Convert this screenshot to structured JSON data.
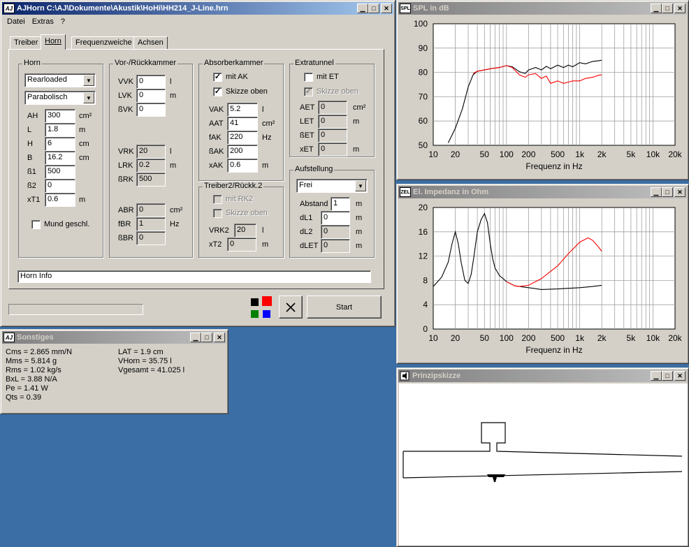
{
  "main_window": {
    "title": "AJHorn  C:\\AJ\\Dokumente\\Akustik\\HoHi\\HH214_J-Line.hrn",
    "icon": "AJ",
    "menu": [
      "Datei",
      "Extras",
      "?"
    ],
    "tabs": [
      "Treiber",
      "Horn",
      "Frequenzweiche",
      "Achsen"
    ],
    "active_tab": "Horn",
    "horn": {
      "label": "Horn",
      "type_select": "Rearloaded",
      "profile_select": "Parabolisch",
      "params": [
        {
          "name": "AH",
          "value": "300",
          "unit": "cm²"
        },
        {
          "name": "L",
          "value": "1.8",
          "unit": "m"
        },
        {
          "name": "H",
          "value": "6",
          "unit": "cm"
        },
        {
          "name": "B",
          "value": "16.2",
          "unit": "cm"
        },
        {
          "name": "ß1",
          "value": "500",
          "unit": ""
        },
        {
          "name": "ß2",
          "value": "0",
          "unit": ""
        },
        {
          "name": "xT1",
          "value": "0.6",
          "unit": "m"
        }
      ],
      "mouth_closed_label": "Mund geschl.",
      "mouth_closed_checked": false
    },
    "vor_rueck": {
      "label": "Vor-/Rückkammer",
      "params_top": [
        {
          "name": "VVK",
          "value": "0",
          "unit": "l"
        },
        {
          "name": "LVK",
          "value": "0",
          "unit": "m"
        },
        {
          "name": "ßVK",
          "value": "0",
          "unit": ""
        }
      ],
      "params_mid": [
        {
          "name": "VRK",
          "value": "20",
          "unit": "l"
        },
        {
          "name": "LRK",
          "value": "0.2",
          "unit": "m"
        },
        {
          "name": "ßRK",
          "value": "500",
          "unit": ""
        }
      ],
      "params_bot": [
        {
          "name": "ABR",
          "value": "0",
          "unit": "cm²"
        },
        {
          "name": "fBR",
          "value": "1",
          "unit": "Hz"
        },
        {
          "name": "ßBR",
          "value": "0",
          "unit": ""
        }
      ]
    },
    "absorber": {
      "label": "Absorberkammer",
      "mit_ak_label": "mit AK",
      "mit_ak_checked": true,
      "skizze_label": "Skizze oben",
      "skizze_checked": true,
      "params": [
        {
          "name": "VAK",
          "value": "5.2",
          "unit": "l"
        },
        {
          "name": "AAT",
          "value": "41",
          "unit": "cm²"
        },
        {
          "name": "fAK",
          "value": "220",
          "unit": "Hz"
        },
        {
          "name": "ßAK",
          "value": "200",
          "unit": ""
        },
        {
          "name": "xAK",
          "value": "0.6",
          "unit": "m"
        }
      ]
    },
    "treiber2": {
      "label": "Treiber2/Rückk.2",
      "mit_rk2_label": "mit RK2",
      "skizze_label": "Skizze oben",
      "params": [
        {
          "name": "VRK2",
          "value": "20",
          "unit": "l"
        },
        {
          "name": "xT2",
          "value": "0",
          "unit": "m"
        }
      ]
    },
    "extratunnel": {
      "label": "Extratunnel",
      "mit_et_label": "mit ET",
      "mit_et_checked": false,
      "skizze_label": "Skizze oben",
      "params": [
        {
          "name": "AET",
          "value": "0",
          "unit": "cm²"
        },
        {
          "name": "LET",
          "value": "0",
          "unit": "m"
        },
        {
          "name": "ßET",
          "value": "0",
          "unit": ""
        },
        {
          "name": "xET",
          "value": "0",
          "unit": "m"
        }
      ]
    },
    "aufstellung": {
      "label": "Aufstellung",
      "select": "Frei",
      "params": [
        {
          "name": "Abstand",
          "value": "1",
          "unit": "m"
        },
        {
          "name": "dL1",
          "value": "0",
          "unit": "m"
        },
        {
          "name": "dL2",
          "value": "0",
          "unit": "m"
        },
        {
          "name": "dLET",
          "value": "0",
          "unit": "m"
        }
      ]
    },
    "horn_info": "Horn Info",
    "start_label": "Start",
    "colors": [
      "#000000",
      "#ff0000",
      "#008000",
      "#0000ff"
    ]
  },
  "sonstiges": {
    "title": "Sonstiges",
    "left": [
      "Cms = 2.865 mm/N",
      "Mms = 5.814 g",
      "Rms = 1.02 kg/s",
      "BxL = 3.88 N/A",
      "Pe = 1.41 W",
      "Qts = 0.39"
    ],
    "right": [
      "LAT = 1.9 cm",
      "VHorn = 35.75 l",
      "Vgesamt = 41.025 l"
    ]
  },
  "spl_window": {
    "title": "SPL in dB",
    "icon": "SPL"
  },
  "imp_window": {
    "title": "El. Impedanz in Ohm",
    "icon": "ZEL"
  },
  "sketch_window": {
    "title": "Prinzipskizze"
  },
  "chart_data": [
    {
      "type": "line",
      "title": "SPL in dB",
      "xlabel": "Frequenz in Hz",
      "ylabel": "",
      "xscale": "log",
      "xlim": [
        10,
        20000
      ],
      "ylim": [
        50,
        100
      ],
      "xticks": [
        10,
        20,
        50,
        100,
        200,
        500,
        1000,
        2000,
        5000,
        10000,
        20000
      ],
      "xtick_labels": [
        "10",
        "20",
        "50",
        "100",
        "200",
        "500",
        "1k",
        "2k",
        "5k",
        "10k",
        "20k"
      ],
      "yticks": [
        50,
        60,
        70,
        80,
        90,
        100
      ],
      "grid": true,
      "series": [
        {
          "color": "#000000",
          "x": [
            16,
            20,
            25,
            30,
            35,
            40,
            50,
            60,
            80,
            100,
            120,
            150,
            180,
            200,
            250,
            300,
            350,
            400,
            500,
            600,
            700,
            800,
            1000,
            1200,
            1500,
            1800,
            2000
          ],
          "y": [
            51,
            57,
            65,
            74,
            79,
            80.5,
            81,
            81.5,
            82,
            82.8,
            82.3,
            80.3,
            79.5,
            81,
            82,
            81,
            82.5,
            81.5,
            83,
            82,
            83,
            82.3,
            84,
            83.5,
            84.5,
            84.8,
            85
          ]
        },
        {
          "color": "#ff0000",
          "x": [
            35,
            40,
            50,
            60,
            80,
            100,
            120,
            150,
            180,
            200,
            250,
            300,
            350,
            400,
            500,
            600,
            700,
            800,
            1000,
            1200,
            1500,
            1800,
            2000
          ],
          "y": [
            79.5,
            80.5,
            81,
            81.5,
            82,
            82.8,
            82,
            79,
            78,
            79,
            79.5,
            77.5,
            78.5,
            75.5,
            76.5,
            75.5,
            76,
            76.5,
            76.5,
            77.5,
            78,
            78.8,
            79
          ]
        }
      ]
    },
    {
      "type": "line",
      "title": "El. Impedanz in Ohm",
      "xlabel": "Frequenz in Hz",
      "ylabel": "",
      "xscale": "log",
      "xlim": [
        10,
        20000
      ],
      "ylim": [
        0,
        20
      ],
      "xticks": [
        10,
        20,
        50,
        100,
        200,
        500,
        1000,
        2000,
        5000,
        10000,
        20000
      ],
      "xtick_labels": [
        "10",
        "20",
        "50",
        "100",
        "200",
        "500",
        "1k",
        "2k",
        "5k",
        "10k",
        "20k"
      ],
      "yticks": [
        0,
        4,
        8,
        12,
        16,
        20
      ],
      "grid": true,
      "series": [
        {
          "color": "#000000",
          "x": [
            10,
            13,
            16,
            18,
            20,
            22,
            24,
            27,
            30,
            33,
            36,
            40,
            45,
            50,
            55,
            60,
            65,
            70,
            80,
            100,
            130,
            150,
            200,
            300,
            500,
            700,
            1000,
            1500,
            2000
          ],
          "y": [
            7,
            8.5,
            11,
            14,
            16,
            14,
            11,
            8,
            7.5,
            9,
            12,
            16,
            18,
            19,
            17.5,
            14,
            11.5,
            10,
            8.8,
            7.8,
            7.1,
            7,
            6.8,
            6.5,
            6.6,
            6.7,
            6.8,
            7,
            7.2
          ]
        },
        {
          "color": "#ff0000",
          "x": [
            100,
            130,
            150,
            200,
            250,
            300,
            400,
            500,
            700,
            1000,
            1300,
            1500,
            1800,
            2000
          ],
          "y": [
            7.8,
            7.1,
            7,
            7.2,
            7.8,
            8.3,
            9.5,
            10.4,
            12.4,
            14.3,
            15,
            14.6,
            13.5,
            12.8
          ]
        }
      ]
    }
  ]
}
